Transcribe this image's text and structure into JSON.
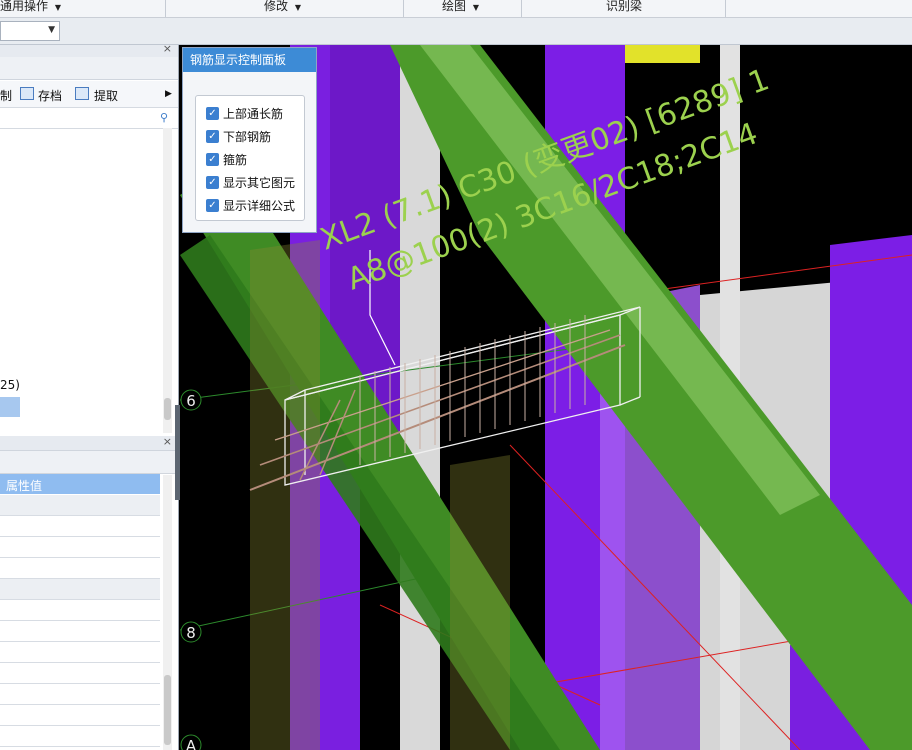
{
  "toolbar": {
    "general_ops": "通用操作",
    "modify": "修改",
    "draw": "绘图",
    "recognize_beam": "识别梁"
  },
  "left_panel": {
    "buttons": {
      "control_fragment": "制",
      "save": "存档",
      "extract": "提取"
    },
    "tree_fragment": "25)",
    "properties": {
      "header_value": "属性值"
    }
  },
  "control_panel": {
    "title": "钢筋显示控制面板",
    "options": [
      {
        "label": "上部通长筋",
        "checked": true
      },
      {
        "label": "下部钢筋",
        "checked": true
      },
      {
        "label": "箍筋",
        "checked": true
      },
      {
        "label": "显示其它图元",
        "checked": true
      },
      {
        "label": "显示详细公式",
        "checked": true
      }
    ]
  },
  "viewport": {
    "annotation_line1": "XL2 (7.1) C30 (变更02) [6289] 1",
    "annotation_line2": "A8@100(2) 3C16/2C18;2C14",
    "axis_labels": [
      "6",
      "8",
      "A"
    ]
  },
  "colors": {
    "purple_column": "#7c1ee6",
    "green_beam": "#4c9a2a",
    "light_grey": "#d8d8d8",
    "annotation_green": "#9cd14e",
    "annotation_grey": "#b9b9b9",
    "panel_title_blue": "#3d8bd6"
  }
}
